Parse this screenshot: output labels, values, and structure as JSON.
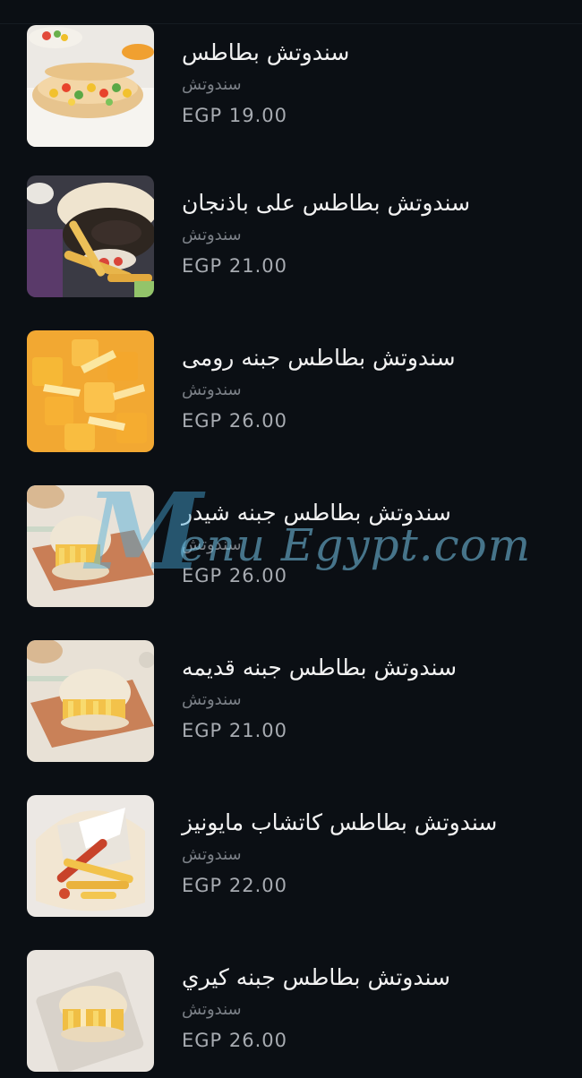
{
  "menu": {
    "items": [
      {
        "name": "سندوتش بطاطس",
        "category": "سندوتش",
        "price": "EGP 19.00",
        "image_icon": "potato-veggie-pita-image"
      },
      {
        "name": "سندوتش بطاطس على باذنجان",
        "category": "سندوتش",
        "price": "EGP 21.00",
        "image_icon": "potato-eggplant-pita-image"
      },
      {
        "name": "سندوتش بطاطس جبنه رومى",
        "category": "سندوتش",
        "price": "EGP 26.00",
        "image_icon": "potato-rumi-cheese-image"
      },
      {
        "name": "سندوتش بطاطس جبنه شيدر",
        "category": "سندوتش",
        "price": "EGP 26.00",
        "image_icon": "potato-cheddar-pita-image"
      },
      {
        "name": "سندوتش بطاطس جبنه قديمه",
        "category": "سندوتش",
        "price": "EGP 21.00",
        "image_icon": "potato-old-cheese-pita-image"
      },
      {
        "name": "سندوتش بطاطس كاتشاب مايونيز",
        "category": "سندوتش",
        "price": "EGP 22.00",
        "image_icon": "potato-ketchup-mayo-wrap-image"
      },
      {
        "name": "سندوتش بطاطس جبنه كيري",
        "category": "سندوتش",
        "price": "EGP 26.00",
        "image_icon": "potato-kiri-cheese-pita-image"
      }
    ]
  },
  "watermark": {
    "initial": "M",
    "text": "enu Egypt.com"
  },
  "colors": {
    "background": "#0b0f14",
    "title": "#f2f2f2",
    "category": "#7b8087",
    "price": "#a7abb1"
  }
}
